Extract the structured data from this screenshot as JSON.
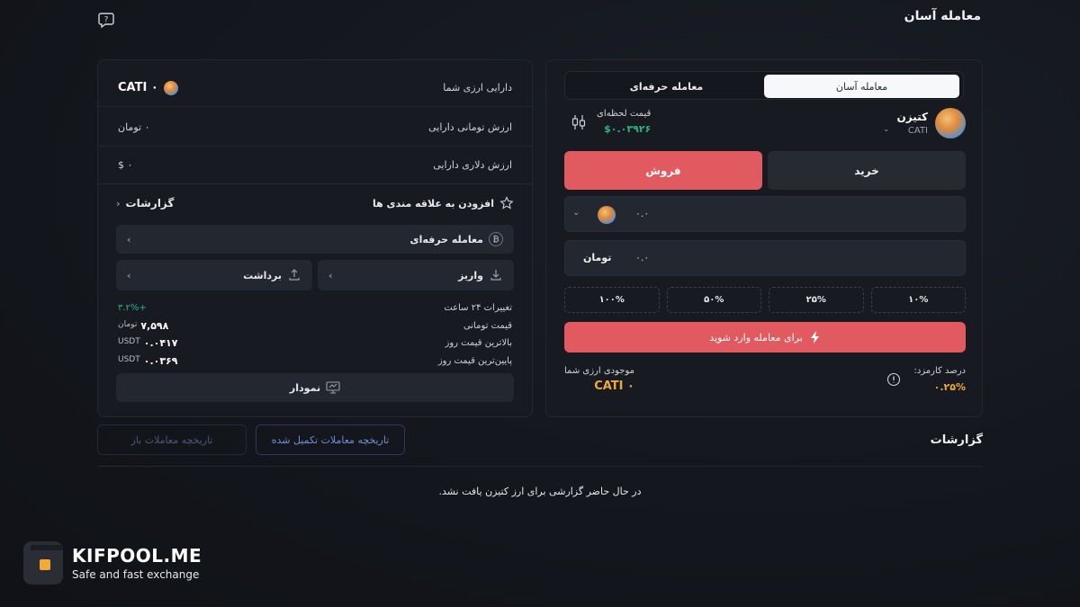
{
  "header": {
    "title": "معامله آسان"
  },
  "holdings": {
    "asset_label": "دارایی ارزی شما",
    "asset_value": "۰ CATI",
    "toman_label": "ارزش تومانی دارایی",
    "toman_value": "۰ تومان",
    "dollar_label": "ارزش دلاری دارایی",
    "dollar_value": "۰ $",
    "favorite_label": "افزودن به علاقه مندی ها",
    "reports_link": "گزارشات",
    "pro_trade_label": "معامله حرفه‌ای",
    "deposit_label": "واریز",
    "withdraw_label": "برداشت",
    "chart_label": "نمودار"
  },
  "stats": [
    {
      "label": "تغییرات ۲۴ ساعت",
      "value": "+۳.۲%",
      "unit": ""
    },
    {
      "label": "قیمت تومانی",
      "value": "۷,۵۹۸",
      "unit": "تومان"
    },
    {
      "label": "بالاترین قیمت روز",
      "value": "۰.۰۴۱۷",
      "unit": "USDT"
    },
    {
      "label": "پایین‌ترین قیمت روز",
      "value": "۰.۰۳۶۹",
      "unit": "USDT"
    }
  ],
  "trade": {
    "tab_easy": "معامله آسان",
    "tab_pro": "معامله حرفه‌ای",
    "asset_name": "کتیزن",
    "asset_symbol": "CATI",
    "live_price_label": "قیمت لحظه‌ای",
    "live_price_value": "$۰.۰۳۹۲۶",
    "buy_label": "خرید",
    "sell_label": "فروش",
    "amount_value": "۰.۰",
    "toman_amount_value": "۰.۰",
    "toman_unit": "تومان",
    "percents": [
      "۱۰%",
      "۲۵%",
      "۵۰%",
      "۱۰۰%"
    ],
    "enter_label": "برای معامله وارد شوید",
    "fee_label": "درصد کارمزد:",
    "fee_value": "۰.۲۵%",
    "balance_label": "موجودی ارزی شما",
    "balance_value": "۰ CATI"
  },
  "reports": {
    "title": "گزارشات",
    "tab_done": "تاریخچه معاملات تکمیل شده",
    "tab_open": "تاریخچه معاملات باز",
    "empty_message": "در حال حاضر گزارشی برای ارز کتیزن یافت نشد."
  },
  "branding": {
    "title": "KIFPOOL.ME",
    "subtitle": "Safe and fast exchange"
  },
  "colors": {
    "sell_accent": "#e05a5f",
    "positive": "#2fb37a",
    "warning": "#f0a93a"
  }
}
